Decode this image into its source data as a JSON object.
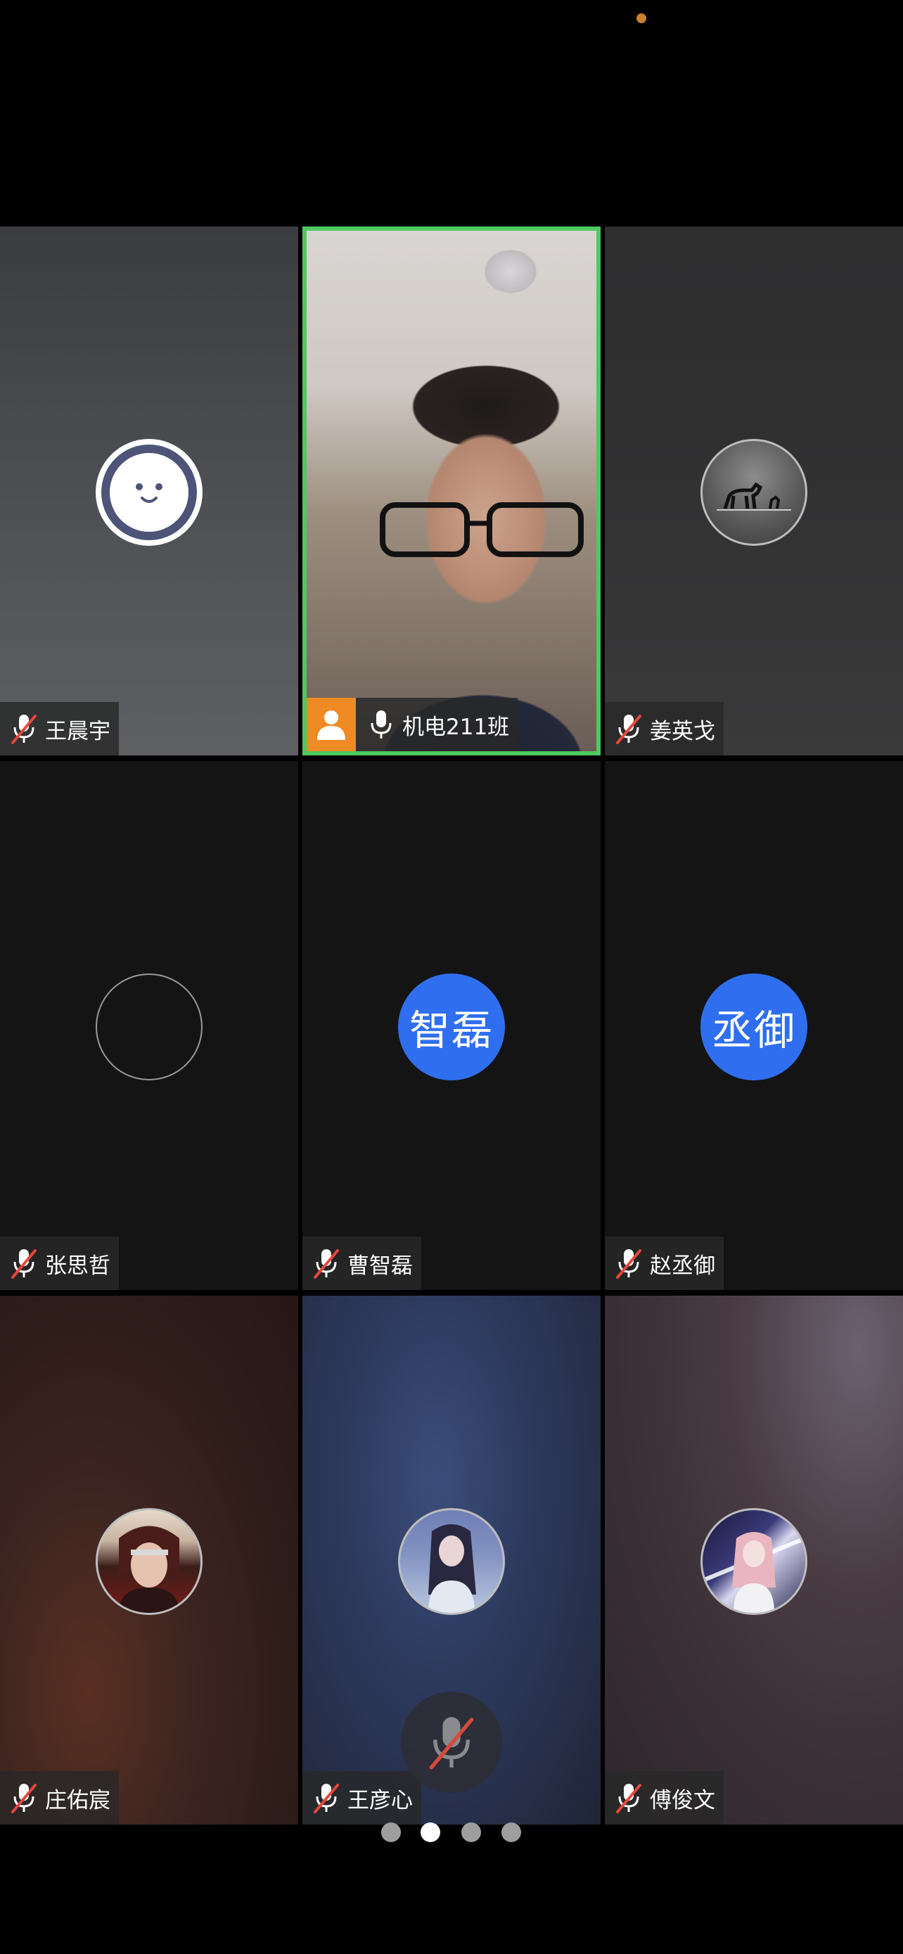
{
  "participants": [
    {
      "name": "王晨宇",
      "muted": true,
      "avatar": "smiley-face-avatar"
    },
    {
      "name": "机电211班",
      "muted": false,
      "host": true,
      "avatar": "live-video"
    },
    {
      "name": "姜英戈",
      "muted": true,
      "avatar": "horse-photo-avatar"
    },
    {
      "name": "张思哲",
      "muted": true,
      "avatar": "empty-circle-avatar"
    },
    {
      "name": "曹智磊",
      "muted": true,
      "avatar_text": "智磊"
    },
    {
      "name": "赵丞御",
      "muted": true,
      "avatar_text": "丞御"
    },
    {
      "name": "庄佑宸",
      "muted": true,
      "avatar": "anime-red-character-avatar"
    },
    {
      "name": "王彦心",
      "muted": true,
      "avatar": "anime-girl-avatar"
    },
    {
      "name": "傅俊文",
      "muted": true,
      "avatar": "anime-pink-hair-avatar"
    }
  ],
  "pager": {
    "total": 4,
    "current": 2
  },
  "colors": {
    "active_border": "#4dc95f",
    "host_badge": "#f08a24",
    "text_avatar": "#2f6fef",
    "status_dot": "#c9812c"
  }
}
